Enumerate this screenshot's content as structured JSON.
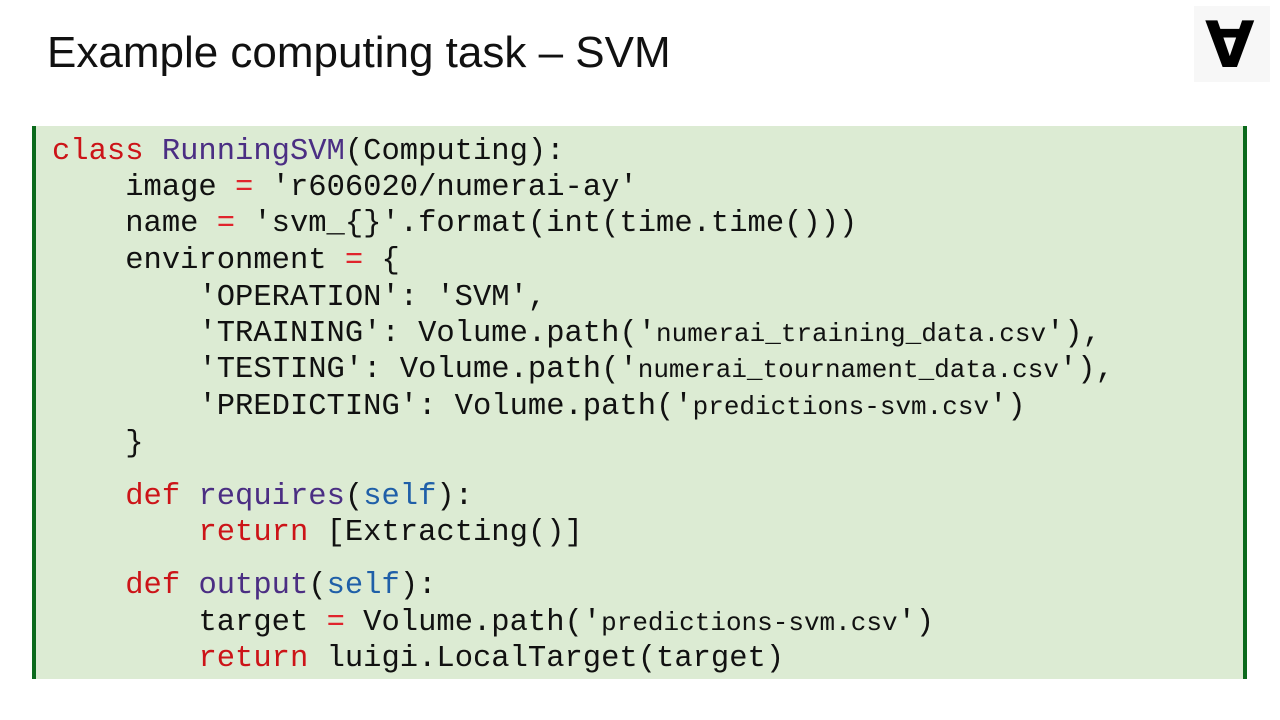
{
  "title": "Example computing task – SVM",
  "logo_glyph": "∀",
  "colors": {
    "keyword": "#cc1418",
    "function_name": "#4b2e83",
    "self": "#1f5fa8",
    "code_background": "#dcebd3",
    "code_border": "#0b6a1c"
  },
  "code": {
    "l1": {
      "kw": "class",
      "name": "RunningSVM",
      "rest": "(Computing):"
    },
    "l2": {
      "indent": "    ",
      "lhs": "image ",
      "op": "=",
      "rhs": " 'r606020/numerai-ay'"
    },
    "l3": {
      "indent": "    ",
      "lhs": "name ",
      "op": "=",
      "rhs": " 'svm_{}'.format(int(time.time()))"
    },
    "l4": {
      "indent": "    ",
      "lhs": "environment ",
      "op": "=",
      "rhs": " {"
    },
    "l5": {
      "indent": "        ",
      "text": "'OPERATION': 'SVM',"
    },
    "l6": {
      "indent": "        ",
      "pre": "'TRAINING': Volume.path('",
      "str": "numerai_training_data.csv",
      "post": "'),"
    },
    "l7": {
      "indent": "        ",
      "pre": "'TESTING': Volume.path('",
      "str": "numerai_tournament_data.csv",
      "post": "'),"
    },
    "l8": {
      "indent": "        ",
      "pre": "'PREDICTING': Volume.path('",
      "str": "predictions-svm.csv",
      "post": "')"
    },
    "l9": {
      "indent": "    ",
      "text": "}"
    },
    "l10": {
      "indent": "    ",
      "kw": "def",
      "name": "requires",
      "open": "(",
      "self": "self",
      "close": "):"
    },
    "l11": {
      "indent": "        ",
      "kw": "return",
      "rest": " [Extracting()]"
    },
    "l12": {
      "indent": "    ",
      "kw": "def",
      "name": "output",
      "open": "(",
      "self": "self",
      "close": "):"
    },
    "l13": {
      "indent": "        ",
      "lhs": "target ",
      "op": "=",
      "pre": " Volume.path('",
      "str": "predictions-svm.csv",
      "post": "')"
    },
    "l14": {
      "indent": "        ",
      "kw": "return",
      "rest": " luigi.LocalTarget(target)"
    }
  }
}
